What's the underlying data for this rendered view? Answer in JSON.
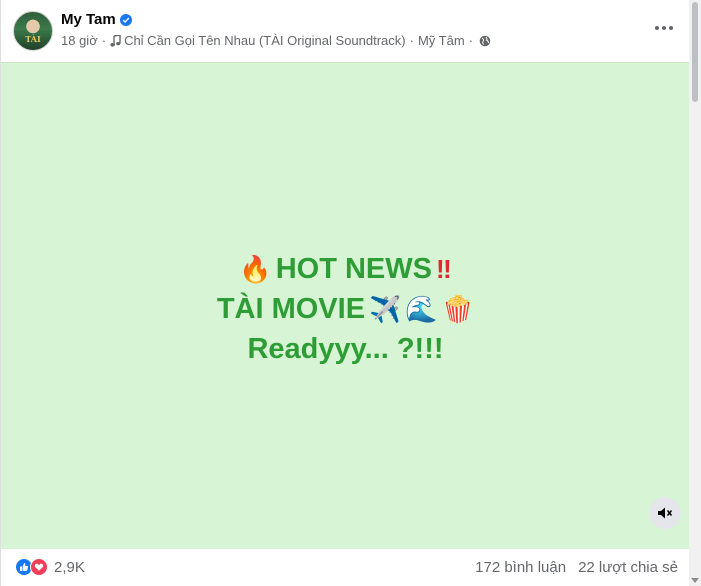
{
  "post": {
    "author": "My Tam",
    "avatar_text": "TÀI",
    "time": "18 giờ",
    "dot": "·",
    "music": "Chỉ Cần Gọi Tên Nhau (TÀI Original Soundtrack)",
    "artist": "Mỹ Tâm",
    "privacy_icon": "globe-icon"
  },
  "media": {
    "line1_text": "HOT NEWS",
    "line1_prefix_emoji": "🔥",
    "line1_suffix_emoji": "‼",
    "line2_text": "TÀI MOVIE",
    "line2_emojis": [
      "✈️",
      "🌊",
      "🍿"
    ],
    "line3_text": "Readyyy... ?!!!",
    "background_color": "#d7f5d5",
    "text_color": "#2e9d35"
  },
  "footer": {
    "reaction_count": "2,9K",
    "comments": "172 bình luận",
    "shares": "22 lượt chia sẻ"
  }
}
